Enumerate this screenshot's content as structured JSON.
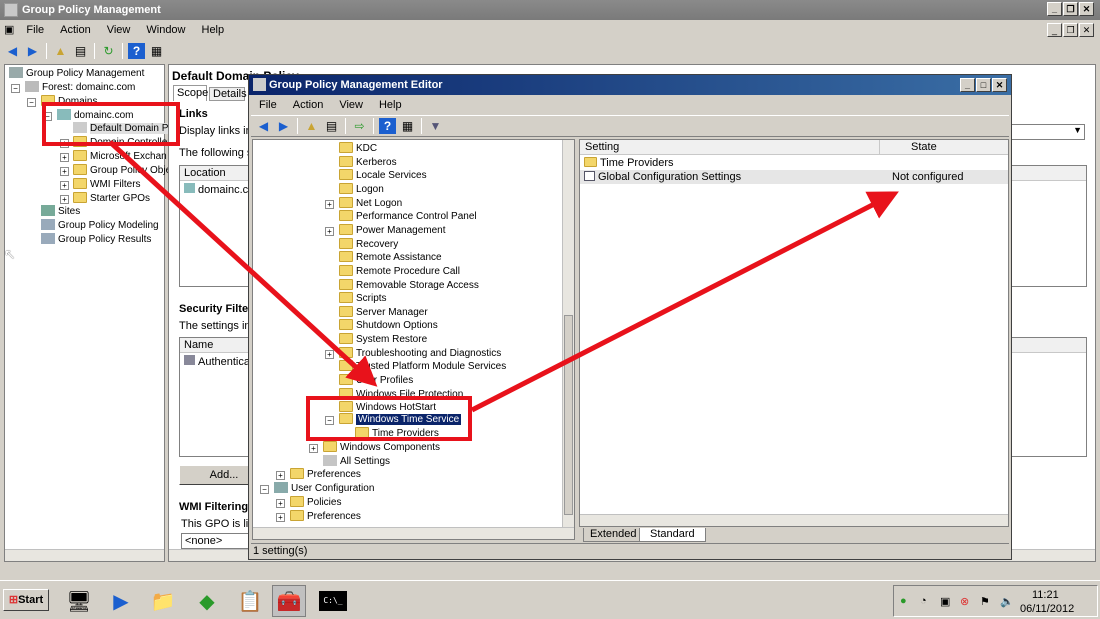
{
  "gpm": {
    "title": "Group Policy Management",
    "menu": [
      "File",
      "Action",
      "View",
      "Window",
      "Help"
    ],
    "tree": {
      "root": "Group Policy Management",
      "forest": "Forest: domainc.com",
      "domains": "Domains",
      "domain": "domainc.com",
      "default_policy": "Default Domain P",
      "children": [
        "Domain Controller",
        "Microsoft Exchan",
        "Group Policy Obje",
        "WMI Filters",
        "Starter GPOs"
      ],
      "sites": "Sites",
      "modeling": "Group Policy Modeling",
      "results": "Group Policy Results"
    },
    "right": {
      "heading": "Default Domain Policy",
      "tabs": [
        "Scope",
        "Details"
      ],
      "links_heading": "Links",
      "links_text": "Display links in th",
      "following_text": "The following site",
      "location_header": "Location",
      "location_row": "domainc.com",
      "security_heading": "Security Filteri",
      "security_text": "The settings in th",
      "name_header": "Name",
      "name_row": "Authenticate",
      "add_button": "Add...",
      "wmi_heading": "WMI Filtering",
      "wmi_text": "This GPO is linke",
      "wmi_value": "<none>"
    }
  },
  "editor": {
    "title": "Group Policy Management Editor",
    "menu": [
      "File",
      "Action",
      "View",
      "Help"
    ],
    "tree": [
      {
        "label": "KDC",
        "exp": false
      },
      {
        "label": "Kerberos",
        "exp": false
      },
      {
        "label": "Locale Services",
        "exp": false
      },
      {
        "label": "Logon",
        "exp": false
      },
      {
        "label": "Net Logon",
        "exp": true
      },
      {
        "label": "Performance Control Panel",
        "exp": false
      },
      {
        "label": "Power Management",
        "exp": true
      },
      {
        "label": "Recovery",
        "exp": false
      },
      {
        "label": "Remote Assistance",
        "exp": false
      },
      {
        "label": "Remote Procedure Call",
        "exp": false
      },
      {
        "label": "Removable Storage Access",
        "exp": false
      },
      {
        "label": "Scripts",
        "exp": false
      },
      {
        "label": "Server Manager",
        "exp": false
      },
      {
        "label": "Shutdown Options",
        "exp": false
      },
      {
        "label": "System Restore",
        "exp": false
      },
      {
        "label": "Troubleshooting and Diagnostics",
        "exp": true
      },
      {
        "label": "Trusted Platform Module Services",
        "exp": false
      },
      {
        "label": "User Profiles",
        "exp": false
      },
      {
        "label": "Windows File Protection",
        "exp": false
      },
      {
        "label": "Windows HotStart",
        "exp": false
      }
    ],
    "selected": "Windows Time Service",
    "time_providers": "Time Providers",
    "windows_components": "Windows Components",
    "all_settings": "All Settings",
    "preferences": "Preferences",
    "user_configuration": "User Configuration",
    "policies": "Policies",
    "preferences2": "Preferences",
    "columns": [
      "Setting",
      "State"
    ],
    "rows": [
      {
        "setting": "Time Providers",
        "state": ""
      },
      {
        "setting": "Global Configuration Settings",
        "state": "Not configured"
      }
    ],
    "tabs": [
      "Extended",
      "Standard"
    ],
    "status": "1 setting(s)"
  },
  "taskbar": {
    "start": "Start",
    "time": "11:21",
    "date": "06/11/2012"
  }
}
